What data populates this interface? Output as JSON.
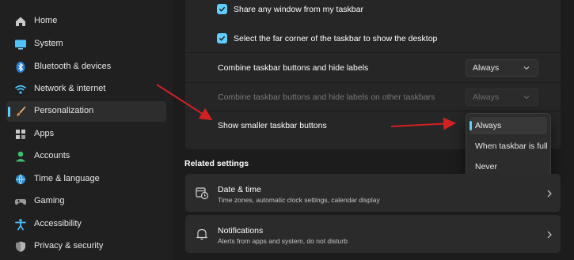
{
  "sidebar": {
    "items": [
      {
        "label": "Home",
        "icon": "home-icon"
      },
      {
        "label": "System",
        "icon": "system-icon"
      },
      {
        "label": "Bluetooth & devices",
        "icon": "bluetooth-icon"
      },
      {
        "label": "Network & internet",
        "icon": "wifi-icon"
      },
      {
        "label": "Personalization",
        "icon": "brush-icon",
        "selected": true
      },
      {
        "label": "Apps",
        "icon": "apps-icon"
      },
      {
        "label": "Accounts",
        "icon": "accounts-icon"
      },
      {
        "label": "Time & language",
        "icon": "globe-icon"
      },
      {
        "label": "Gaming",
        "icon": "gamepad-icon"
      },
      {
        "label": "Accessibility",
        "icon": "accessibility-icon"
      },
      {
        "label": "Privacy & security",
        "icon": "shield-icon"
      }
    ]
  },
  "taskbar_behaviors": {
    "share_window": {
      "label": "Share any window from my taskbar",
      "checked": true
    },
    "far_corner": {
      "label": "Select the far corner of the taskbar to show the desktop",
      "checked": true
    },
    "combine_buttons": {
      "label": "Combine taskbar buttons and hide labels",
      "value": "Always"
    },
    "combine_other": {
      "label": "Combine taskbar buttons and hide labels on other taskbars",
      "value": "Always",
      "disabled": true
    },
    "smaller_buttons": {
      "label": "Show smaller taskbar buttons"
    }
  },
  "dropdown": {
    "options": [
      "Always",
      "When taskbar is full",
      "Never"
    ],
    "selected": "Always"
  },
  "related": {
    "title": "Related settings",
    "cards": [
      {
        "title": "Date & time",
        "subtitle": "Time zones, automatic clock settings, calendar display",
        "icon": "calendar-clock-icon"
      },
      {
        "title": "Notifications",
        "subtitle": "Alerts from apps and system, do not disturb",
        "icon": "bell-icon"
      }
    ]
  },
  "colors": {
    "accent": "#60cdff",
    "annotation_arrow": "#d42020",
    "background": "#1c1c1c",
    "sidebar": "#202020",
    "card": "#2b2b2b"
  }
}
